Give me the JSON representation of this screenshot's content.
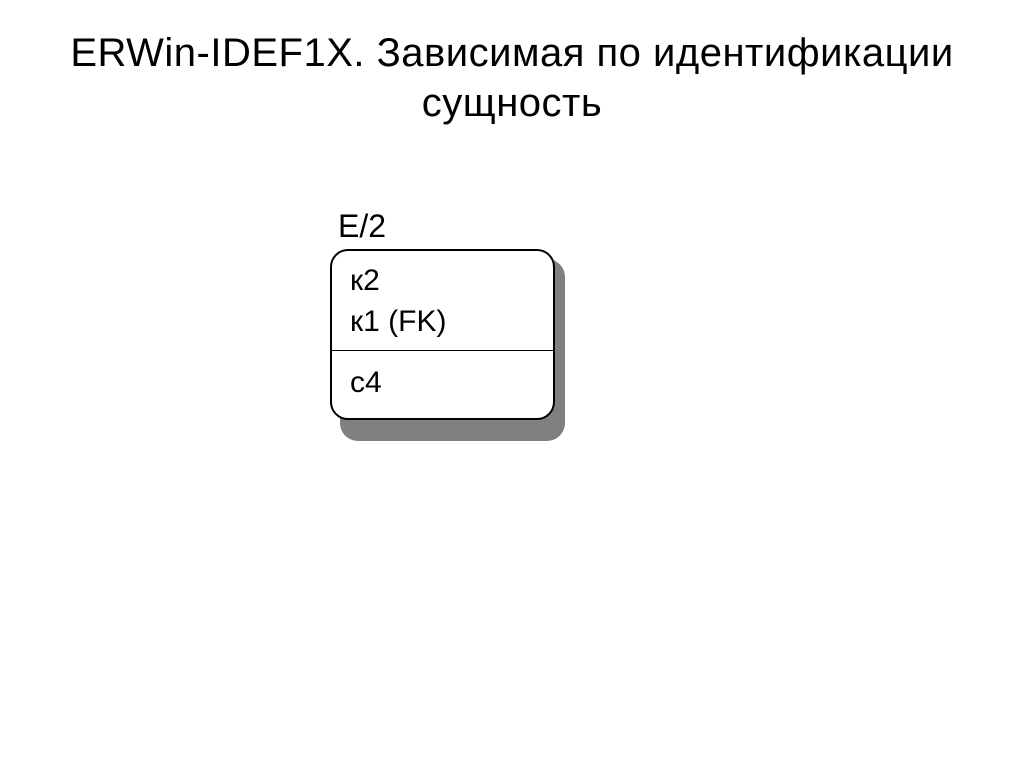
{
  "title": "ERWin-IDEF1X. Зависимая по идентификации сущность",
  "entity": {
    "name": "E/2",
    "key_attributes": [
      "к2",
      "к1 (FK)"
    ],
    "non_key_attributes": [
      "с4"
    ]
  }
}
